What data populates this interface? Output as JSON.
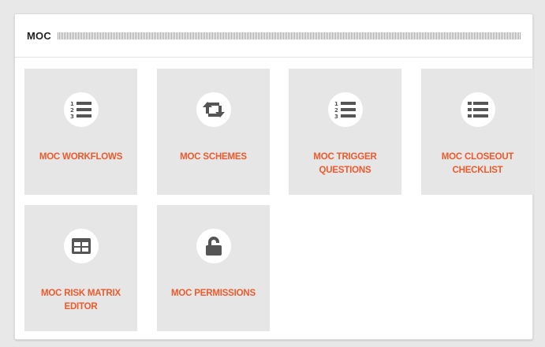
{
  "panel": {
    "title": "MOC"
  },
  "tiles": [
    {
      "label": "MOC WORKFLOWS",
      "icon": "numbered-list-icon"
    },
    {
      "label": "MOC SCHEMES",
      "icon": "retweet-icon"
    },
    {
      "label": "MOC TRIGGER QUESTIONS",
      "icon": "numbered-list-icon"
    },
    {
      "label": "MOC CLOSEOUT CHECKLIST",
      "icon": "bulleted-list-icon"
    },
    {
      "label": "MOC RISK MATRIX EDITOR",
      "icon": "table-icon"
    },
    {
      "label": "MOC PERMISSIONS",
      "icon": "unlock-icon"
    }
  ],
  "colors": {
    "accent": "#ee5a2b",
    "tile_bg": "#e6e6e6",
    "icon": "#555555"
  }
}
